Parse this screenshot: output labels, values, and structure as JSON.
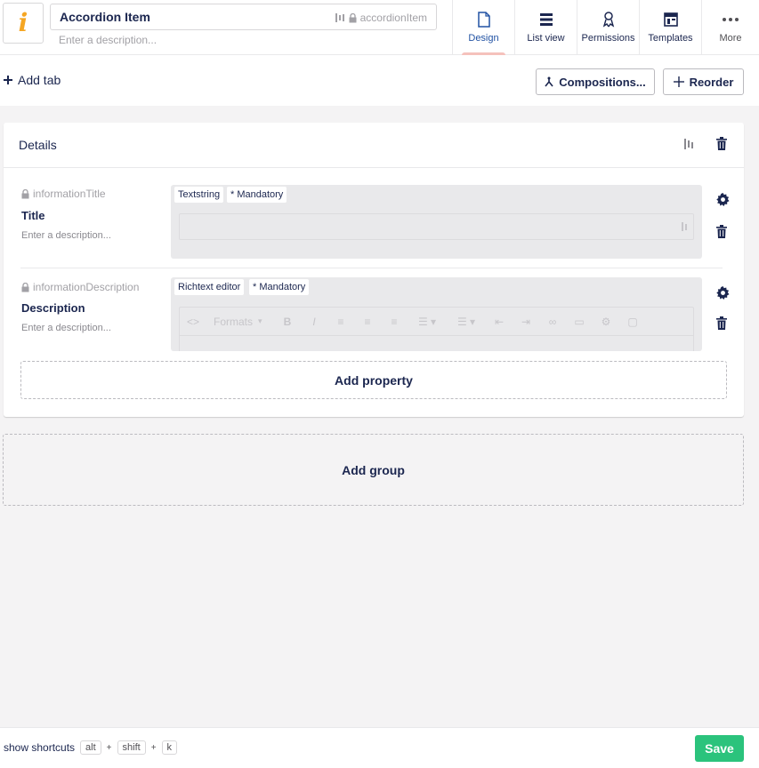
{
  "header": {
    "icon_glyph": "i",
    "name": "Accordion Item",
    "alias": "accordionItem",
    "description_placeholder": "Enter a description...",
    "nav": [
      {
        "label": "Design",
        "icon": "document-icon"
      },
      {
        "label": "List view",
        "icon": "list-icon"
      },
      {
        "label": "Permissions",
        "icon": "permissions-icon"
      },
      {
        "label": "Templates",
        "icon": "templates-icon"
      },
      {
        "label": "More",
        "icon": "more-icon"
      }
    ]
  },
  "toolbar": {
    "add_tab": "Add tab",
    "compositions": "Compositions...",
    "reorder": "Reorder"
  },
  "group": {
    "name": "Details",
    "properties": [
      {
        "alias": "informationTitle",
        "label": "Title",
        "description_placeholder": "Enter a description...",
        "editor": "Textstring",
        "mandatory": "* Mandatory"
      },
      {
        "alias": "informationDescription",
        "label": "Description",
        "description_placeholder": "Enter a description...",
        "editor": "Richtext editor",
        "mandatory": "* Mandatory",
        "rte_formats": "Formats"
      }
    ],
    "add_property": "Add property"
  },
  "add_group": "Add group",
  "footer": {
    "show_shortcuts": "show shortcuts",
    "keys": [
      "alt",
      "shift",
      "k"
    ],
    "save": "Save"
  },
  "colors": {
    "accent": "#2152a3",
    "primary_text": "#1b264f",
    "save": "#2bc37c",
    "icon_orange": "#f5a623"
  }
}
